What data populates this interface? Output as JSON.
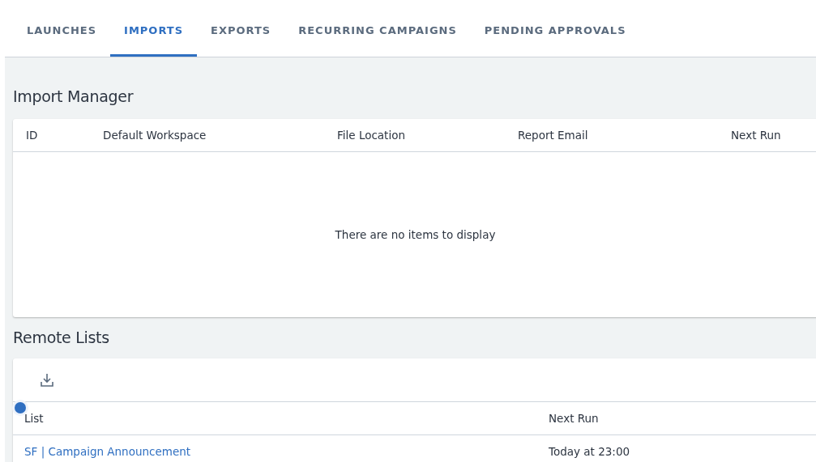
{
  "tabs": [
    {
      "label": "LAUNCHES",
      "selected": false
    },
    {
      "label": "IMPORTS",
      "selected": true
    },
    {
      "label": "EXPORTS",
      "selected": false
    },
    {
      "label": "RECURRING CAMPAIGNS",
      "selected": false
    },
    {
      "label": "PENDING APPROVALS",
      "selected": false
    }
  ],
  "import_manager": {
    "title": "Import Manager",
    "columns": [
      "ID",
      "Default Workspace",
      "File Location",
      "Report Email",
      "Next Run"
    ],
    "empty_message": "There are no items to display"
  },
  "remote_lists": {
    "title": "Remote Lists",
    "columns": [
      "List",
      "Next Run"
    ],
    "rows": [
      {
        "list": "SF | Campaign Announcement",
        "next_run": "Today at 23:00"
      }
    ]
  }
}
